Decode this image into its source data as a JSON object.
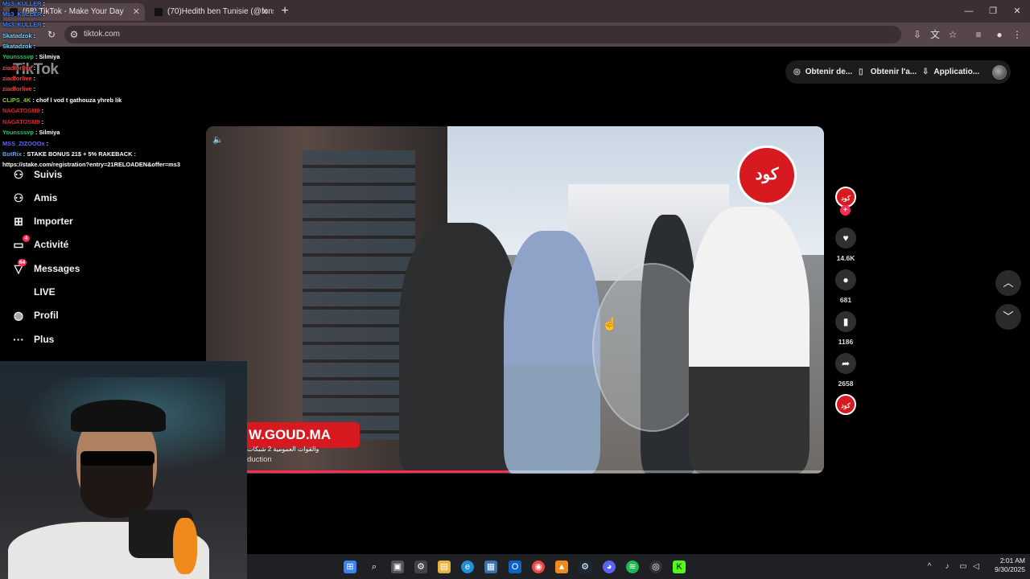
{
  "browser": {
    "tabs": [
      {
        "title": "(68) TikTok - Make Your Day",
        "active": true,
        "audio": true
      },
      {
        "title": "(70)Hedith ben Tunisie (@fons...",
        "active": false
      }
    ],
    "url": "tiktok.com"
  },
  "tiktok": {
    "logo": "TikTok",
    "header_buttons": [
      "Obtenir de...",
      "Obtenir l'a...",
      "Applicatio..."
    ],
    "sidebar": [
      {
        "label": "Suivis",
        "icon": "following-icon"
      },
      {
        "label": "Amis",
        "icon": "friends-icon"
      },
      {
        "label": "Importer",
        "icon": "upload-icon"
      },
      {
        "label": "Activité",
        "icon": "activity-icon",
        "badge": "4"
      },
      {
        "label": "Messages",
        "icon": "messages-icon",
        "badge": "64"
      },
      {
        "label": "LIVE",
        "icon": "live-icon"
      },
      {
        "label": "Profil",
        "icon": "profile-icon"
      },
      {
        "label": "Plus",
        "icon": "more-icon"
      }
    ],
    "video": {
      "watermark": "W.GOUD.MA",
      "subtitle_ar": "والقوات العمومية 2 شبكات",
      "credit": "duction",
      "channel_logo": "كود",
      "progress": 0.49
    },
    "actions": {
      "likes": "14.6K",
      "comments": "681",
      "saves": "1186",
      "shares": "2658"
    }
  },
  "chat": [
    {
      "user": "Ms3_KULLER",
      "text": ":",
      "color": "#3b82f6"
    },
    {
      "user": "Ms3_KULLER",
      "text": ":",
      "color": "#3b82f6"
    },
    {
      "user": "Ms3_KULLER",
      "text": ":",
      "color": "#3b82f6"
    },
    {
      "user": "Skatadzok",
      "text": ":",
      "color": "#7dd3fc"
    },
    {
      "user": "Skatadzok",
      "text": ":",
      "color": "#7dd3fc"
    },
    {
      "user": "Younsssvp",
      "text": ": Silmiya",
      "color": "#22c55e"
    },
    {
      "user": "ziadforlive",
      "text": ":",
      "color": "#ef4444"
    },
    {
      "user": "ziadforlive",
      "text": ":",
      "color": "#ef4444"
    },
    {
      "user": "ziadforlive",
      "text": ":",
      "color": "#ef4444"
    },
    {
      "user": "CLIPS_4K",
      "text": ": chof l vod t gathouza yhreb lik",
      "color": "#84cc16"
    },
    {
      "user": "NAGATOSM9",
      "text": ":",
      "color": "#dc2626"
    },
    {
      "user": "NAGATOSM9",
      "text": ":",
      "color": "#dc2626"
    },
    {
      "user": "Younsssvp",
      "text": ": Silmiya",
      "color": "#22c55e"
    },
    {
      "user": "MSS_ZIZOOOx",
      "text": ":",
      "color": "#6366f1"
    },
    {
      "user": "BotRix",
      "text": ": STAKE BONUS 21$ + 5% RAKEBACK :",
      "color": "#60a5fa"
    },
    {
      "user": "",
      "text": "https://stake.com/registration?entry=21RELOADEN&offer=ms3",
      "color": "#ffffff"
    }
  ],
  "taskbar": {
    "apps": [
      "start",
      "search",
      "task-view",
      "settings",
      "file-explorer",
      "edge",
      "store",
      "outlook",
      "chrome",
      "vlc",
      "steam",
      "discord",
      "spotify",
      "obs",
      "kick"
    ],
    "time": "2:01 AM",
    "date": "9/30/2025"
  }
}
